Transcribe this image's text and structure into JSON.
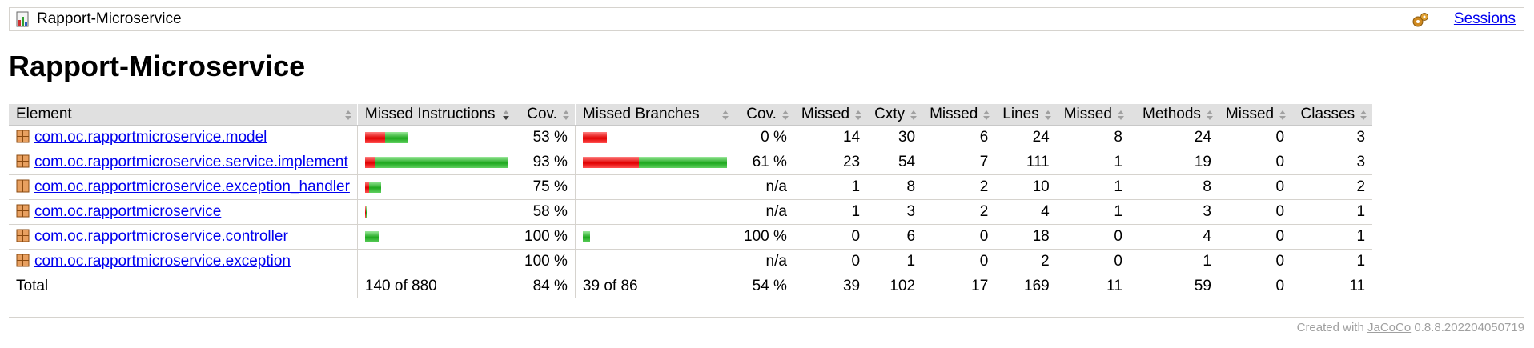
{
  "breadcrumb": {
    "title": "Rapport-Microservice",
    "sessions_label": "Sessions"
  },
  "page_title": "Rapport-Microservice",
  "table": {
    "headers": [
      "Element",
      "Missed Instructions",
      "Cov.",
      "Missed Branches",
      "Cov.",
      "Missed",
      "Cxty",
      "Missed",
      "Lines",
      "Missed",
      "Methods",
      "Missed",
      "Classes"
    ],
    "rows": [
      {
        "name": "com.oc.rapportmicroservice.model",
        "instr_cov": "53 %",
        "branch_cov": "0 %",
        "missed_cxty": "14",
        "cxty": "30",
        "missed_lines": "6",
        "lines": "24",
        "missed_methods": "8",
        "methods": "24",
        "missed_classes": "0",
        "classes": "3"
      },
      {
        "name": "com.oc.rapportmicroservice.service.implement",
        "instr_cov": "93 %",
        "branch_cov": "61 %",
        "missed_cxty": "23",
        "cxty": "54",
        "missed_lines": "7",
        "lines": "111",
        "missed_methods": "1",
        "methods": "19",
        "missed_classes": "0",
        "classes": "3"
      },
      {
        "name": "com.oc.rapportmicroservice.exception_handler",
        "instr_cov": "75 %",
        "branch_cov": "n/a",
        "missed_cxty": "1",
        "cxty": "8",
        "missed_lines": "2",
        "lines": "10",
        "missed_methods": "1",
        "methods": "8",
        "missed_classes": "0",
        "classes": "2"
      },
      {
        "name": "com.oc.rapportmicroservice",
        "instr_cov": "58 %",
        "branch_cov": "n/a",
        "missed_cxty": "1",
        "cxty": "3",
        "missed_lines": "2",
        "lines": "4",
        "missed_methods": "1",
        "methods": "3",
        "missed_classes": "0",
        "classes": "1"
      },
      {
        "name": "com.oc.rapportmicroservice.controller",
        "instr_cov": "100 %",
        "branch_cov": "100 %",
        "missed_cxty": "0",
        "cxty": "6",
        "missed_lines": "0",
        "lines": "18",
        "missed_methods": "0",
        "methods": "4",
        "missed_classes": "0",
        "classes": "1"
      },
      {
        "name": "com.oc.rapportmicroservice.exception",
        "instr_cov": "100 %",
        "branch_cov": "n/a",
        "missed_cxty": "0",
        "cxty": "1",
        "missed_lines": "0",
        "lines": "2",
        "missed_methods": "0",
        "methods": "1",
        "missed_classes": "0",
        "classes": "1"
      }
    ],
    "total": {
      "label": "Total",
      "instr": "140 of 880",
      "instr_cov": "84 %",
      "branch": "39 of 86",
      "branch_cov": "54 %",
      "missed_cxty": "39",
      "cxty": "102",
      "missed_lines": "17",
      "lines": "169",
      "missed_methods": "11",
      "methods": "59",
      "missed_classes": "0",
      "classes": "11"
    }
  },
  "footer": {
    "prefix": "Created with ",
    "link": "JaCoCo",
    "version": " 0.8.8.202204050719"
  },
  "colors": {
    "covered": "#1ea81e",
    "missed": "#e00000",
    "header_bg": "#e0e0e0",
    "link": "#0000ee"
  }
}
